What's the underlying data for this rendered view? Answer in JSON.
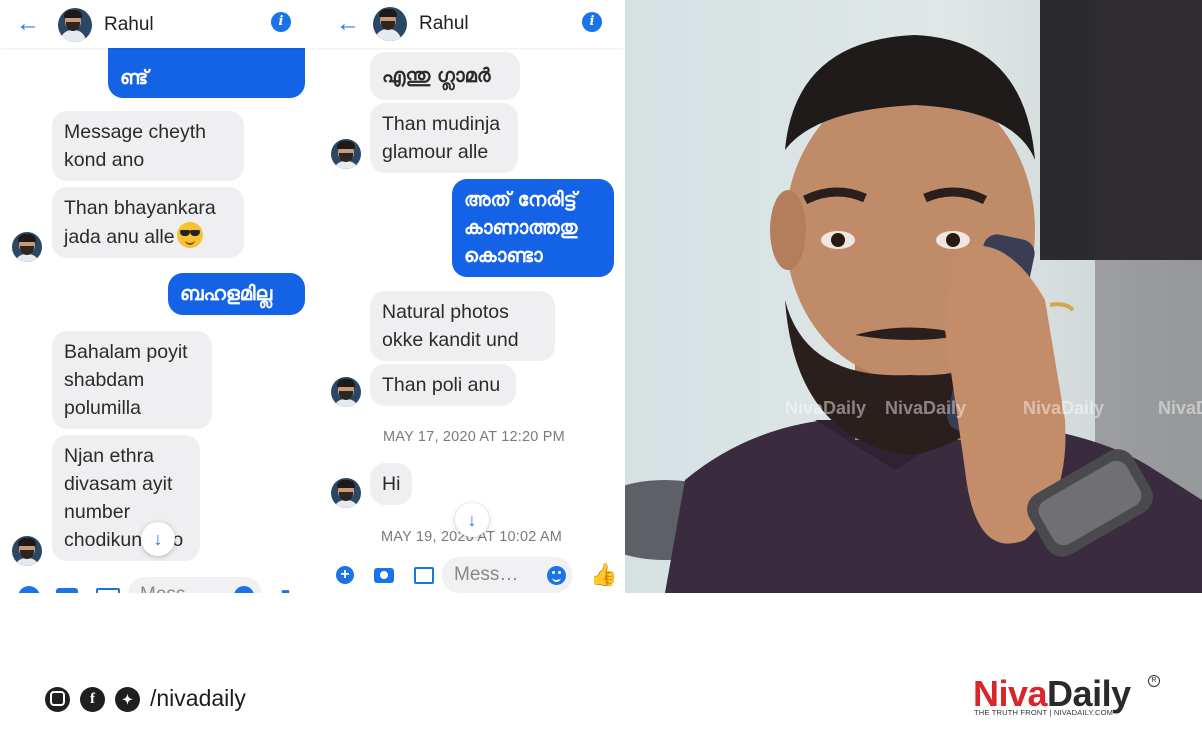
{
  "chat1": {
    "contact_name": "Rahul",
    "messages": [
      {
        "side": "out",
        "text": "ണ്ട്"
      },
      {
        "side": "in",
        "text": "Message cheyth\nkond ano"
      },
      {
        "side": "in",
        "text": "Than bhayankara\njada anu alle"
      },
      {
        "side": "out",
        "text": "ബഹളമില്ല"
      },
      {
        "side": "in",
        "text": "Bahalam poyit\nshabdam\npolumilla"
      },
      {
        "side": "in",
        "text": "Njan ethra\ndivasam ayit\nnumber\nchodikunnallo"
      }
    ],
    "input_placeholder": "Mess…"
  },
  "chat2": {
    "contact_name": "Rahul",
    "messages": [
      {
        "side": "in",
        "text": "എന്തു ഗ്ലാമർ"
      },
      {
        "side": "in",
        "text": "Than mudinja\nglamour alle"
      },
      {
        "side": "out",
        "text": "അത് നേരിട്ട്\nകാണാത്തതു\nകൊണ്ടാ"
      },
      {
        "side": "in",
        "text": "Natural photos\nokke kandit und"
      },
      {
        "side": "in",
        "text": "Than poli anu"
      },
      {
        "side": "in",
        "text": "Hi"
      }
    ],
    "timestamps": [
      "MAY 17, 2020 AT 12:20 PM",
      "MAY 19, 2020 AT 10:02 AM"
    ],
    "input_placeholder": "Mess…"
  },
  "icons": [
    "back-arrow-icon",
    "info-icon",
    "scroll-down-icon",
    "plus-icon",
    "camera-icon",
    "gallery-icon",
    "emoji-icon",
    "thumbs-up-icon",
    "sunglasses-emoji-icon",
    "instagram-icon",
    "facebook-icon",
    "twitter-icon"
  ],
  "photo": {
    "watermark": "NivaDaily"
  },
  "footer": {
    "social_handle": "/nivadaily",
    "logo_niva": "Niva",
    "logo_daily": "Daily",
    "logo_registered": "R",
    "tagline": "THE TRUTH FRONT | NIVADAILY.COM"
  },
  "colors": {
    "messenger_blue": "#1463e6",
    "accent": "#1a73e8",
    "brand_red": "#d9262c"
  }
}
